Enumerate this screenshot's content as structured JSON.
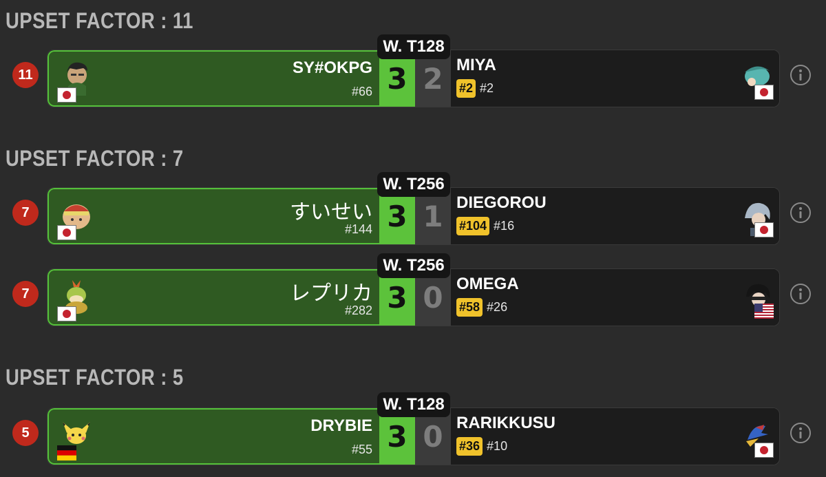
{
  "sections": [
    {
      "header": "UPSET FACTOR : 11",
      "matches": [
        {
          "upset_factor": "11",
          "round": "W. T128",
          "winner": {
            "name": "SY#OKPG",
            "seed": "#66",
            "score": "3",
            "flag": "JP",
            "character_icon": "character-dark-hair-icon"
          },
          "loser": {
            "name": "MIYA",
            "rank_badge": "#2",
            "seed": "#2",
            "score": "2",
            "flag": "JP",
            "character_icon": "character-teal-hair-icon"
          }
        }
      ]
    },
    {
      "header": "UPSET FACTOR : 7",
      "matches": [
        {
          "upset_factor": "7",
          "round": "W. T256",
          "winner": {
            "name": "すいせい",
            "seed": "#144",
            "score": "3",
            "flag": "JP",
            "character_icon": "character-king-dedede-icon"
          },
          "loser": {
            "name": "DIEGOROU",
            "rank_badge": "#104",
            "seed": "#16",
            "score": "1",
            "flag": "JP",
            "character_icon": "character-silver-hair-icon"
          }
        },
        {
          "upset_factor": "7",
          "round": "W. T256",
          "winner": {
            "name": "レプリカ",
            "seed": "#282",
            "score": "3",
            "flag": "JP",
            "character_icon": "character-bowser-jr-icon"
          },
          "loser": {
            "name": "OMEGA",
            "rank_badge": "#58",
            "seed": "#26",
            "score": "0",
            "flag": "US",
            "character_icon": "character-joker-icon"
          }
        }
      ]
    },
    {
      "header": "UPSET FACTOR : 5",
      "matches": [
        {
          "upset_factor": "5",
          "round": "W. T128",
          "winner": {
            "name": "DRYBIE",
            "seed": "#55",
            "score": "3",
            "flag": "DE",
            "character_icon": "character-pichu-icon"
          },
          "loser": {
            "name": "RARIKKUSU",
            "rank_badge": "#36",
            "seed": "#10",
            "score": "0",
            "flag": "JP",
            "character_icon": "character-falco-icon"
          }
        }
      ]
    }
  ],
  "colors": {
    "background": "#2b2b2b",
    "header_text": "#b8b8b8",
    "winner_panel": "#2f5a22",
    "winner_border": "#55c13a",
    "winner_score_bg": "#5cc23b",
    "loser_panel": "#1c1c1c",
    "rank_chip": "#f0c22b",
    "upset_badge": "#c0291c"
  }
}
